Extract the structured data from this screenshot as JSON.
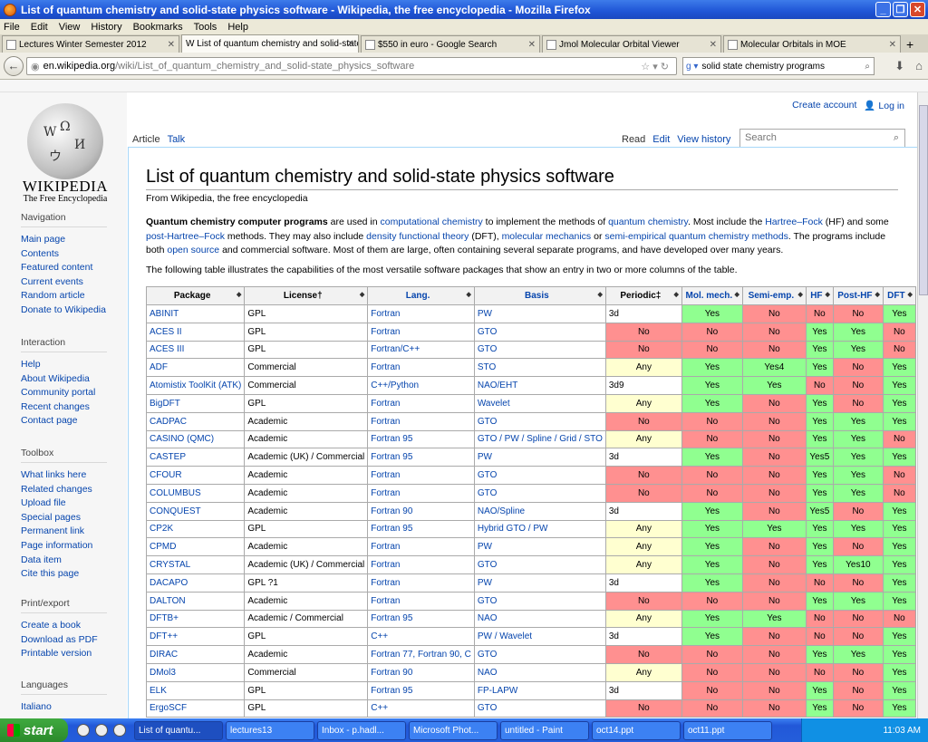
{
  "window": {
    "title": "List of quantum chemistry and solid-state physics software - Wikipedia, the free encyclopedia - Mozilla Firefox"
  },
  "menu": [
    "File",
    "Edit",
    "View",
    "History",
    "Bookmarks",
    "Tools",
    "Help"
  ],
  "tabs": [
    "Lectures Winter Semester 2012",
    "W List of quantum chemistry and solid-state...",
    "$550 in euro - Google Search",
    "Jmol Molecular Orbital Viewer",
    "Molecular Orbitals in MOE"
  ],
  "url": {
    "host": "en.wikipedia.org",
    "path": "/wiki/List_of_quantum_chemistry_and_solid-state_physics_software"
  },
  "browser_search": "solid state chemistry programs",
  "wiki": {
    "wordmark": "WIKIPEDIA",
    "tagline": "The Free Encyclopedia",
    "create": "Create account",
    "login": "Log in",
    "article_tab": "Article",
    "talk_tab": "Talk",
    "read": "Read",
    "edit": "Edit",
    "history": "View history",
    "search_placeholder": "Search",
    "title": "List of quantum chemistry and solid-state physics software",
    "from": "From Wikipedia, the free encyclopedia",
    "p2": "The following table illustrates the capabilities of the most versatile software packages that show an entry in two or more columns of the table."
  },
  "portals": [
    {
      "heading": "Navigation",
      "items": [
        "Main page",
        "Contents",
        "Featured content",
        "Current events",
        "Random article",
        "Donate to Wikipedia"
      ]
    },
    {
      "heading": "Interaction",
      "items": [
        "Help",
        "About Wikipedia",
        "Community portal",
        "Recent changes",
        "Contact page"
      ]
    },
    {
      "heading": "Toolbox",
      "items": [
        "What links here",
        "Related changes",
        "Upload file",
        "Special pages",
        "Permanent link",
        "Page information",
        "Data item",
        "Cite this page"
      ]
    },
    {
      "heading": "Print/export",
      "items": [
        "Create a book",
        "Download as PDF",
        "Printable version"
      ]
    },
    {
      "heading": "Languages",
      "items": [
        "Italiano"
      ]
    }
  ],
  "table": {
    "headers": [
      "Package",
      "License†",
      "Lang.",
      "Basis",
      "Periodic‡",
      "Mol. mech.",
      "Semi-emp.",
      "HF",
      "Post-HF",
      "DFT"
    ],
    "rows": [
      [
        "ABINIT",
        "GPL",
        "Fortran",
        "PW",
        "3d",
        "Yes",
        "No",
        "No",
        "No",
        "Yes"
      ],
      [
        "ACES II",
        "GPL",
        "Fortran",
        "GTO",
        "No",
        "No",
        "No",
        "Yes",
        "Yes",
        "No"
      ],
      [
        "ACES III",
        "GPL",
        "Fortran/C++",
        "GTO",
        "No",
        "No",
        "No",
        "Yes",
        "Yes",
        "No"
      ],
      [
        "ADF",
        "Commercial",
        "Fortran",
        "STO",
        "Any",
        "Yes",
        "Yes4",
        "Yes",
        "No",
        "Yes"
      ],
      [
        "Atomistix ToolKit (ATK)",
        "Commercial",
        "C++/Python",
        "NAO/EHT",
        "3d9",
        "Yes",
        "Yes",
        "No",
        "No",
        "Yes"
      ],
      [
        "BigDFT",
        "GPL",
        "Fortran",
        "Wavelet",
        "Any",
        "Yes",
        "No",
        "Yes",
        "No",
        "Yes"
      ],
      [
        "CADPAC",
        "Academic",
        "Fortran",
        "GTO",
        "No",
        "No",
        "No",
        "Yes",
        "Yes",
        "Yes"
      ],
      [
        "CASINO (QMC)",
        "Academic",
        "Fortran 95",
        "GTO / PW / Spline / Grid / STO",
        "Any",
        "No",
        "No",
        "Yes",
        "Yes",
        "No"
      ],
      [
        "CASTEP",
        "Academic (UK) / Commercial",
        "Fortran 95",
        "PW",
        "3d",
        "Yes",
        "No",
        "Yes5",
        "Yes",
        "Yes"
      ],
      [
        "CFOUR",
        "Academic",
        "Fortran",
        "GTO",
        "No",
        "No",
        "No",
        "Yes",
        "Yes",
        "No"
      ],
      [
        "COLUMBUS",
        "Academic",
        "Fortran",
        "GTO",
        "No",
        "No",
        "No",
        "Yes",
        "Yes",
        "No"
      ],
      [
        "CONQUEST",
        "Academic",
        "Fortran 90",
        "NAO/Spline",
        "3d",
        "Yes",
        "No",
        "Yes5",
        "No",
        "Yes"
      ],
      [
        "CP2K",
        "GPL",
        "Fortran 95",
        "Hybrid GTO / PW",
        "Any",
        "Yes",
        "Yes",
        "Yes",
        "Yes",
        "Yes"
      ],
      [
        "CPMD",
        "Academic",
        "Fortran",
        "PW",
        "Any",
        "Yes",
        "No",
        "Yes",
        "No",
        "Yes"
      ],
      [
        "CRYSTAL",
        "Academic (UK) / Commercial",
        "Fortran",
        "GTO",
        "Any",
        "Yes",
        "No",
        "Yes",
        "Yes10",
        "Yes"
      ],
      [
        "DACAPO",
        "GPL ?1",
        "Fortran",
        "PW",
        "3d",
        "Yes",
        "No",
        "No",
        "No",
        "Yes"
      ],
      [
        "DALTON",
        "Academic",
        "Fortran",
        "GTO",
        "No",
        "No",
        "No",
        "Yes",
        "Yes",
        "Yes"
      ],
      [
        "DFTB+",
        "Academic / Commercial",
        "Fortran 95",
        "NAO",
        "Any",
        "Yes",
        "Yes",
        "No",
        "No",
        "No"
      ],
      [
        "DFT++",
        "GPL",
        "C++",
        "PW / Wavelet",
        "3d",
        "Yes",
        "No",
        "No",
        "No",
        "Yes"
      ],
      [
        "DIRAC",
        "Academic",
        "Fortran 77, Fortran 90, C",
        "GTO",
        "No",
        "No",
        "No",
        "Yes",
        "Yes",
        "Yes"
      ],
      [
        "DMol3",
        "Commercial",
        "Fortran 90",
        "NAO",
        "Any",
        "No",
        "No",
        "No",
        "No",
        "Yes"
      ],
      [
        "ELK",
        "GPL",
        "Fortran 95",
        "FP-LAPW",
        "3d",
        "No",
        "No",
        "Yes",
        "No",
        "Yes"
      ],
      [
        "ErgoSCF",
        "GPL",
        "C++",
        "GTO",
        "No",
        "No",
        "No",
        "Yes",
        "No",
        "Yes"
      ]
    ]
  },
  "taskbar": {
    "start": "start",
    "buttons": [
      "List of quantu...",
      "lectures13",
      "Inbox - p.hadl...",
      "Microsoft Phot...",
      "untitled - Paint",
      "oct14.ppt",
      "oct11.ppt"
    ],
    "clock": "11:03 AM"
  }
}
